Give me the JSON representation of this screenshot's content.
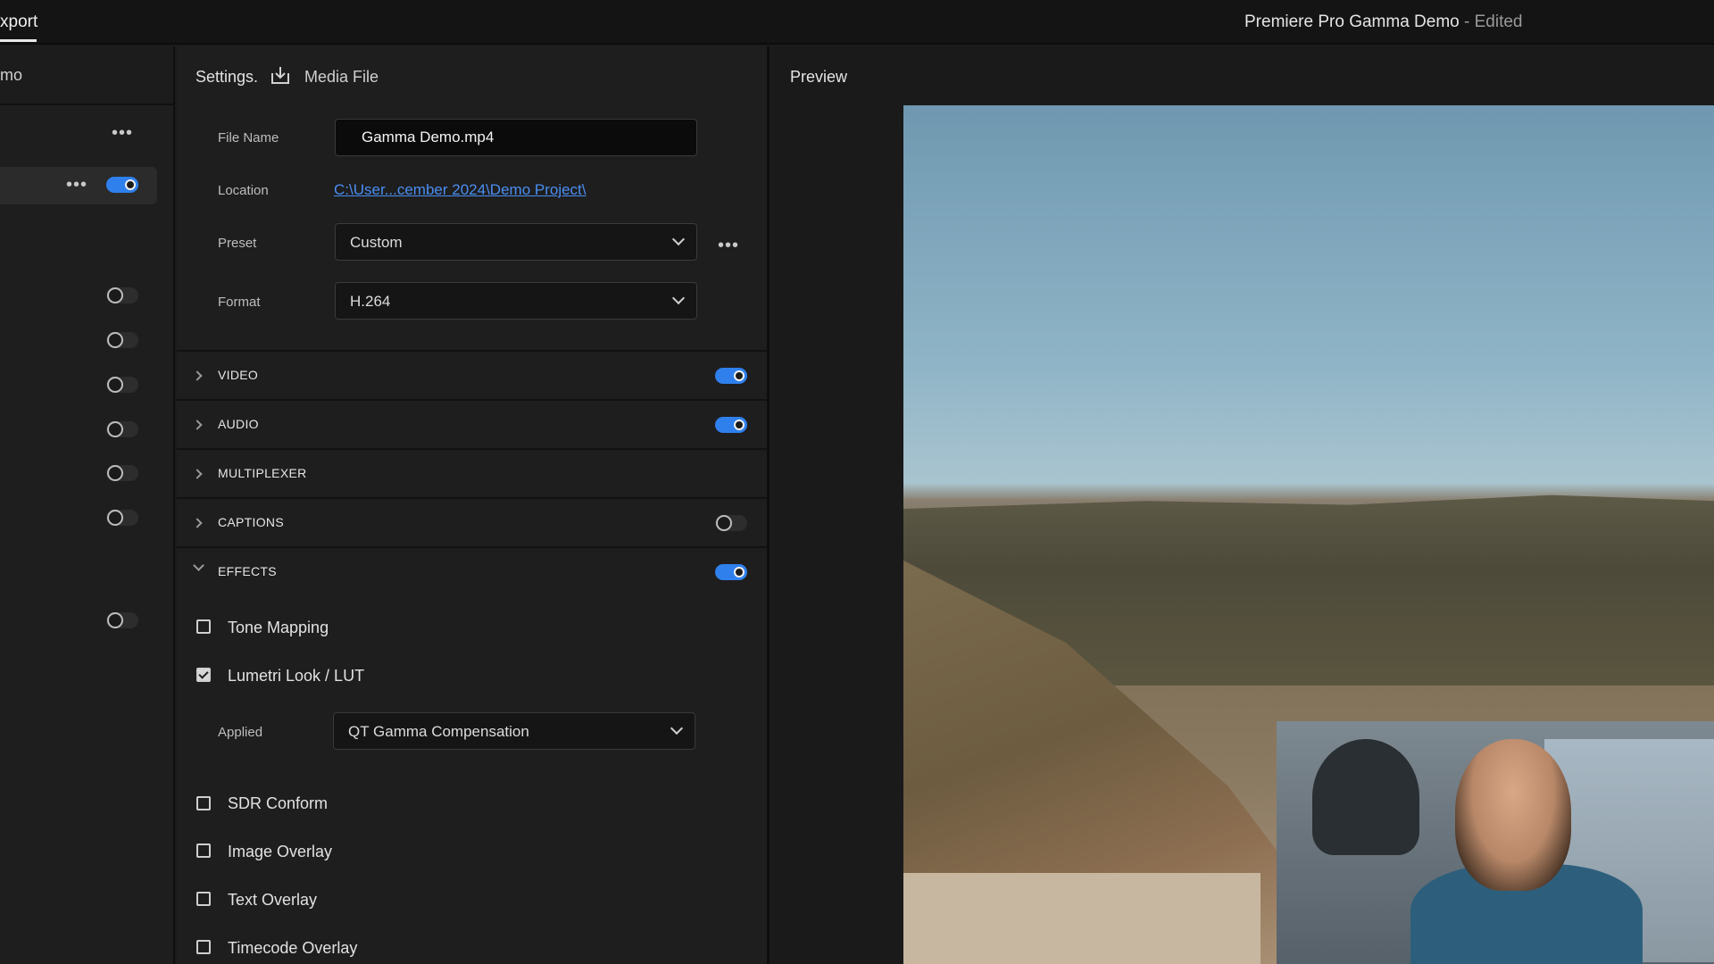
{
  "topbar": {
    "tab_label": "xport",
    "title": "Premiere Pro Gamma Demo",
    "title_suffix": " - Edited"
  },
  "source_panel": {
    "header_name": "mo",
    "toggles": [
      {
        "state": "on"
      },
      {
        "state": "off"
      },
      {
        "state": "off"
      },
      {
        "state": "off"
      },
      {
        "state": "off"
      },
      {
        "state": "off"
      },
      {
        "state": "off"
      },
      {
        "state": "off"
      },
      {
        "state": "off"
      }
    ]
  },
  "settings": {
    "header_label": "Settings.",
    "media_file_label": "Media File",
    "file_name": {
      "label": "File Name",
      "value": "Gamma Demo.mp4"
    },
    "location": {
      "label": "Location",
      "value": "C:\\User...cember 2024\\Demo Project\\"
    },
    "preset": {
      "label": "Preset",
      "value": "Custom"
    },
    "format": {
      "label": "Format",
      "value": "H.264"
    },
    "sections": [
      {
        "label": "VIDEO",
        "toggle": "on",
        "expanded": false
      },
      {
        "label": "AUDIO",
        "toggle": "on",
        "expanded": false
      },
      {
        "label": "MULTIPLEXER",
        "toggle": "none",
        "expanded": false
      },
      {
        "label": "CAPTIONS",
        "toggle": "off",
        "expanded": false
      },
      {
        "label": "EFFECTS",
        "toggle": "on",
        "expanded": true
      }
    ],
    "effects": {
      "tone_mapping": {
        "label": "Tone Mapping",
        "checked": false
      },
      "lumetri": {
        "label": "Lumetri Look / LUT",
        "checked": true
      },
      "applied": {
        "label": "Applied",
        "value": "QT Gamma Compensation"
      },
      "sdr_conform": {
        "label": "SDR Conform",
        "checked": false
      },
      "image_overlay": {
        "label": "Image Overlay",
        "checked": false
      },
      "text_overlay": {
        "label": "Text Overlay",
        "checked": false
      },
      "timecode_overlay": {
        "label": "Timecode Overlay",
        "checked": false
      }
    }
  },
  "preview": {
    "title": "Preview"
  },
  "colors": {
    "accent": "#2f80ed",
    "link": "#4a8ef2",
    "panel_bg": "#1e1e1e"
  }
}
